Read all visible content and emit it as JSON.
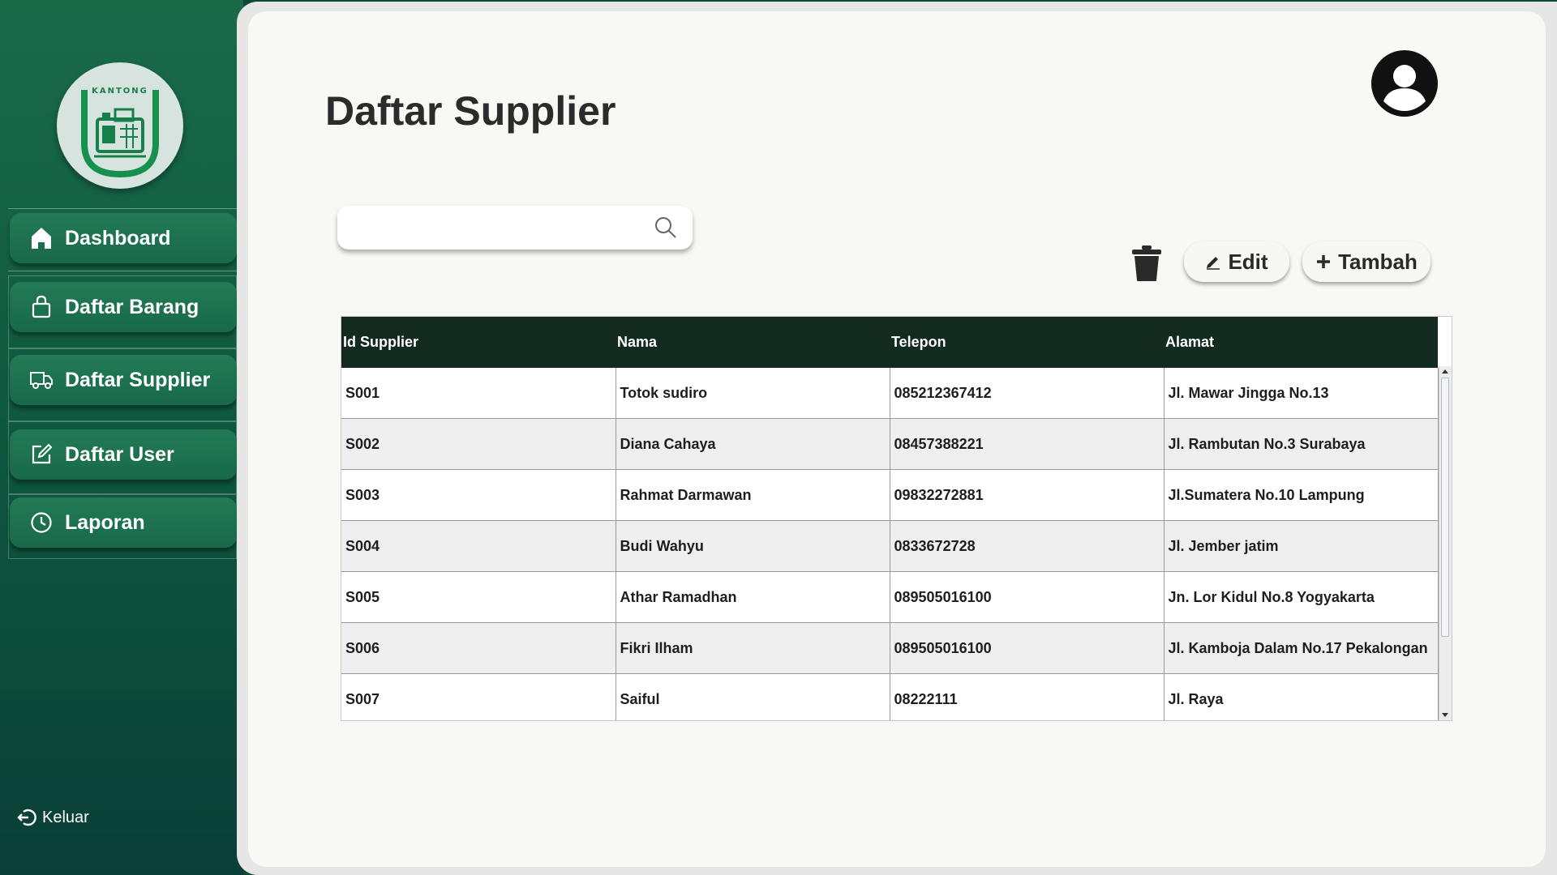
{
  "app": {
    "logo_text": "KANTONG"
  },
  "sidebar": {
    "items": [
      {
        "label": "Dashboard",
        "icon": "home-icon"
      },
      {
        "label": "Daftar Barang",
        "icon": "shopping-bag-icon"
      },
      {
        "label": "Daftar Supplier",
        "icon": "truck-icon"
      },
      {
        "label": "Daftar User",
        "icon": "edit-square-icon"
      },
      {
        "label": "Laporan",
        "icon": "clock-icon"
      }
    ],
    "logout_label": "Keluar"
  },
  "main": {
    "title": "Daftar Supplier",
    "search": {
      "placeholder": "",
      "value": ""
    },
    "toolbar": {
      "edit_label": "Edit",
      "add_label": "Tambah"
    }
  },
  "table": {
    "columns": [
      "Id Supplier",
      "Nama",
      "Telepon",
      "Alamat"
    ],
    "rows": [
      [
        "S001",
        "Totok sudiro",
        "085212367412",
        "Jl. Mawar Jingga No.13"
      ],
      [
        "S002",
        "Diana Cahaya",
        "08457388221",
        "Jl. Rambutan No.3 Surabaya"
      ],
      [
        "S003",
        "Rahmat Darmawan",
        "09832272881",
        "Jl.Sumatera No.10 Lampung"
      ],
      [
        "S004",
        "Budi Wahyu",
        "0833672728",
        "Jl. Jember jatim"
      ],
      [
        "S005",
        "Athar Ramadhan",
        "089505016100",
        "Jn. Lor Kidul No.8 Yogyakarta"
      ],
      [
        "S006",
        "Fikri Ilham",
        "089505016100",
        "Jl. Kamboja Dalam No.17 Pekalongan"
      ],
      [
        "S007",
        "Saiful",
        "08222111",
        "Jl. Raya"
      ],
      [
        "",
        "",
        "",
        ""
      ]
    ]
  },
  "colors": {
    "sidebar_top": "#1a6a4a",
    "sidebar_bottom": "#0a3f36",
    "table_header": "#132a1e",
    "logo_green": "#16804a"
  }
}
